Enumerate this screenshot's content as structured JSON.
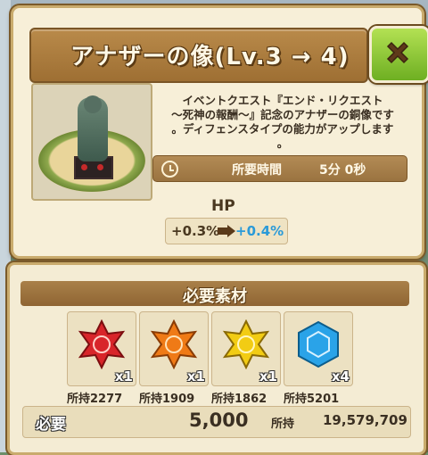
{
  "dialog": {
    "title": "アナザーの像(Lv.3 → 4)",
    "description_lines": [
      "イベントクエスト『エンド・リクエスト",
      "～死神の報酬～』記念のアナザーの銅像です",
      "。ディフェンスタイプの能力がアップします",
      "。"
    ],
    "time_label": "所要時間",
    "time_value": "5分 0秒",
    "stat": {
      "name": "HP",
      "current": "+0.3%",
      "next": "+0.4%"
    },
    "icons": {
      "close": "close-x-icon",
      "clock": "clock-icon",
      "arrow": "arrow-right-icon"
    }
  },
  "materials": {
    "title": "必要素材",
    "items": [
      {
        "icon": "red-star-crystal-icon",
        "color": "#d8252a",
        "qty": "x1",
        "owned": "所持2277"
      },
      {
        "icon": "orange-star-crystal-icon",
        "color": "#ef7a16",
        "qty": "x1",
        "owned": "所持1909"
      },
      {
        "icon": "yellow-star-crystal-icon",
        "color": "#f2cc14",
        "qty": "x1",
        "owned": "所持1862"
      },
      {
        "icon": "blue-hexagon-crystal-icon",
        "color": "#2aa3e8",
        "qty": "x4",
        "owned": "所持5201"
      }
    ],
    "required_label": "必要",
    "cost": "5,000",
    "owned_label": "所持",
    "owned_value": "19,579,709"
  },
  "colors": {
    "accent_green": "#7fbf2a",
    "panel_brown": "#9e6f33",
    "stat_up_blue": "#2a9ad8"
  }
}
